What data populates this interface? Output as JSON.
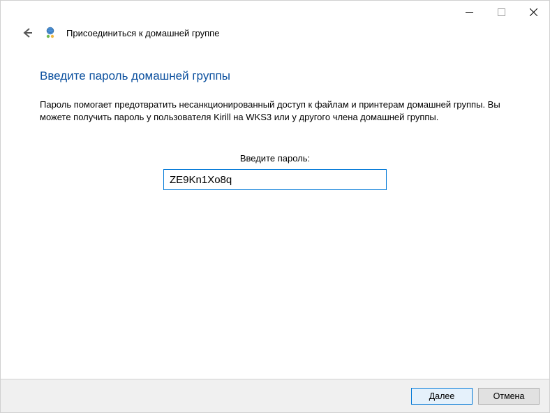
{
  "titlebar": {
    "minimize": "–",
    "maximize": "▢",
    "close": "✕"
  },
  "header": {
    "title": "Присоединиться к домашней группе"
  },
  "content": {
    "heading": "Введите пароль домашней группы",
    "description": "Пароль помогает предотвратить несанкционированный доступ к файлам и принтерам домашней группы. Вы можете получить пароль у пользователя Kirill на WKS3 или у другого члена домашней группы.",
    "field_label": "Введите пароль:",
    "password_value": "ZE9Kn1Xo8q"
  },
  "footer": {
    "next": "Далее",
    "cancel": "Отмена"
  }
}
